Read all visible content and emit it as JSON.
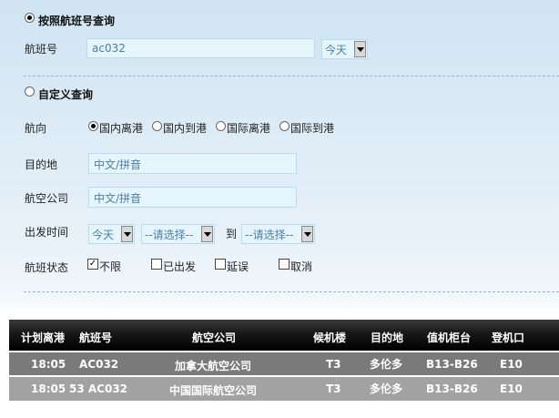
{
  "flight_query": {
    "title": "按照航班号查询",
    "selected": true,
    "flight_no_label": "航班号",
    "flight_no_value": "ac032",
    "day_select": "今天"
  },
  "custom_query": {
    "title": "自定义查询",
    "selected": false,
    "direction_label": "航向",
    "directions": [
      "国内离港",
      "国内到港",
      "国际离港",
      "国际到港"
    ],
    "direction_selected": 0,
    "destination_label": "目的地",
    "destination_placeholder": "中文/拼音",
    "airline_label": "航空公司",
    "airline_placeholder": "中文/拼音",
    "depart_time_label": "出发时间",
    "depart_day": "今天",
    "time_from": "--请选择--",
    "to_label": "到",
    "time_to": "--请选择--",
    "status_label": "航班状态",
    "statuses": [
      {
        "label": "不限",
        "checked": true
      },
      {
        "label": "已出发",
        "checked": false
      },
      {
        "label": "延误",
        "checked": false
      },
      {
        "label": "取消",
        "checked": false
      }
    ]
  },
  "results": {
    "headers": [
      "计划离港",
      "航班号",
      "航空公司",
      "候机楼",
      "目的地",
      "值机柜台",
      "登机口"
    ],
    "rows": [
      [
        "18:05",
        "AC032",
        "加拿大航空公司",
        "T3",
        "多伦多",
        "B13-B26",
        "E10"
      ],
      [
        "18:05",
        "53 AC032",
        "中国国际航空公司",
        "T3",
        "多伦多",
        "B13-B26",
        "E10"
      ]
    ],
    "colors": {
      "header": "#000000",
      "row1": "#7a7a7a",
      "row2": "#a2a2a2"
    }
  }
}
